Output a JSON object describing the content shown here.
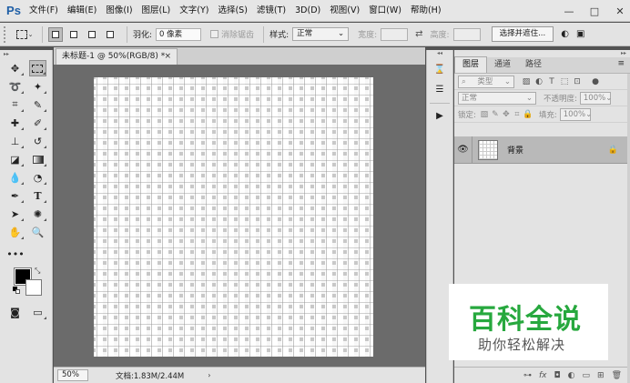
{
  "app": {
    "logo": "Ps"
  },
  "menu": [
    "文件(F)",
    "编辑(E)",
    "图像(I)",
    "图层(L)",
    "文字(Y)",
    "选择(S)",
    "滤镜(T)",
    "3D(D)",
    "视图(V)",
    "窗口(W)",
    "帮助(H)"
  ],
  "window": {
    "minimize": "—",
    "restore": "□",
    "close": "✕"
  },
  "options": {
    "feather_label": "羽化:",
    "feather_value": "0 像素",
    "antialias_label": "消除锯齿",
    "style_label": "样式:",
    "style_value": "正常",
    "width_label": "宽度:",
    "height_label": "高度:",
    "select_mask_button": "选择并遮住..."
  },
  "document": {
    "tab_title": "未标题-1 @ 50%(RGB/8) *",
    "close": "×"
  },
  "status": {
    "zoom": "50%",
    "doc_info": "文档:1.83M/2.44M",
    "arrow": "›"
  },
  "panel": {
    "tabs": [
      "图层",
      "通道",
      "路径"
    ],
    "filter_kind": "类型",
    "blend_mode": "正常",
    "opacity_label": "不透明度:",
    "opacity_value": "100%",
    "lock_label": "锁定:",
    "fill_label": "填充:",
    "fill_value": "100%",
    "layer_name": "背景"
  },
  "watermark": {
    "title": "百科全说",
    "subtitle": "助你轻松解决"
  },
  "colors": {
    "foreground": "#000000",
    "background": "#ffffff",
    "watermark_green": "#27a83e"
  }
}
